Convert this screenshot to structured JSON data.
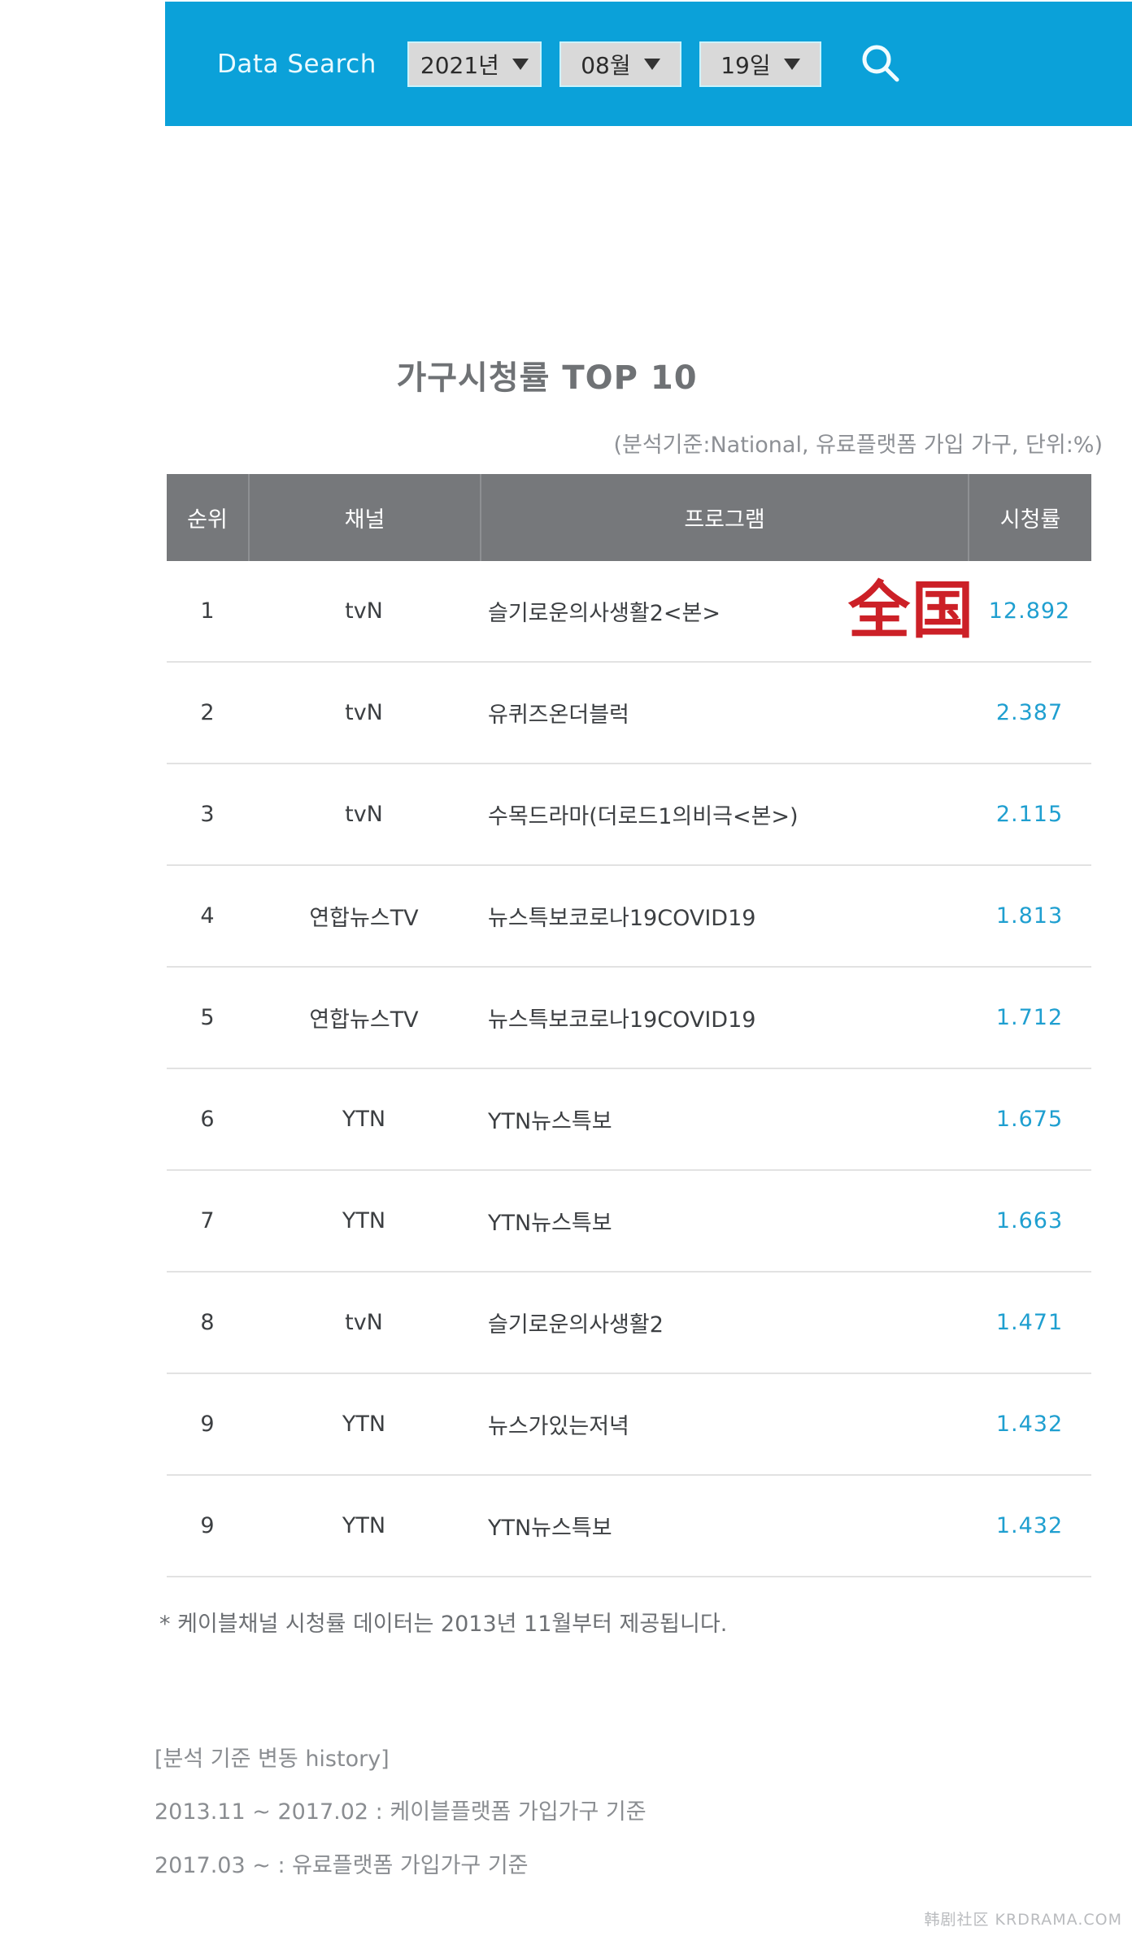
{
  "search": {
    "label": "Data Search",
    "year": {
      "value": "2021년",
      "icon": "chevron-down-icon"
    },
    "month": {
      "value": "08월",
      "icon": "chevron-down-icon"
    },
    "day": {
      "value": "19일",
      "icon": "chevron-down-icon"
    },
    "submit_icon": "search-icon"
  },
  "report": {
    "title": "가구시청률 TOP 10",
    "subtitle": "(분석기준:National, 유료플랫폼 가입 가구, 단위:%)",
    "stamp": "全国"
  },
  "table": {
    "headers": [
      "순위",
      "채널",
      "프로그램",
      "시청률"
    ],
    "rows": [
      {
        "rank": "1",
        "channel": "tvN",
        "program": "슬기로운의사생활2<본>",
        "rating": "12.892"
      },
      {
        "rank": "2",
        "channel": "tvN",
        "program": "유퀴즈온더블럭",
        "rating": "2.387"
      },
      {
        "rank": "3",
        "channel": "tvN",
        "program": "수목드라마(더로드1의비극<본>)",
        "rating": "2.115"
      },
      {
        "rank": "4",
        "channel": "연합뉴스TV",
        "program": "뉴스특보코로나19COVID19",
        "rating": "1.813"
      },
      {
        "rank": "5",
        "channel": "연합뉴스TV",
        "program": "뉴스특보코로나19COVID19",
        "rating": "1.712"
      },
      {
        "rank": "6",
        "channel": "YTN",
        "program": "YTN뉴스특보",
        "rating": "1.675"
      },
      {
        "rank": "7",
        "channel": "YTN",
        "program": "YTN뉴스특보",
        "rating": "1.663"
      },
      {
        "rank": "8",
        "channel": "tvN",
        "program": "슬기로운의사생활2",
        "rating": "1.471"
      },
      {
        "rank": "9",
        "channel": "YTN",
        "program": "뉴스가있는저녁",
        "rating": "1.432"
      },
      {
        "rank": "9",
        "channel": "YTN",
        "program": "YTN뉴스특보",
        "rating": "1.432"
      }
    ]
  },
  "notes": {
    "footnote": "* 케이블채널 시청률 데이터는 2013년 11월부터 제공됩니다.",
    "history_title": "[분석 기준 변동 history]",
    "history_1": "2013.11 ~ 2017.02 : 케이블플랫폼 가입가구 기준",
    "history_2": "2017.03 ~ : 유료플랫폼 가입가구 기준"
  },
  "watermark": "韩剧社区 KRDRAMA.COM",
  "colors": {
    "accent_blue": "#0ba1d9",
    "rating_blue": "#1f9fd0",
    "header_gray": "#76787b",
    "stamp_red": "#cc2027"
  }
}
